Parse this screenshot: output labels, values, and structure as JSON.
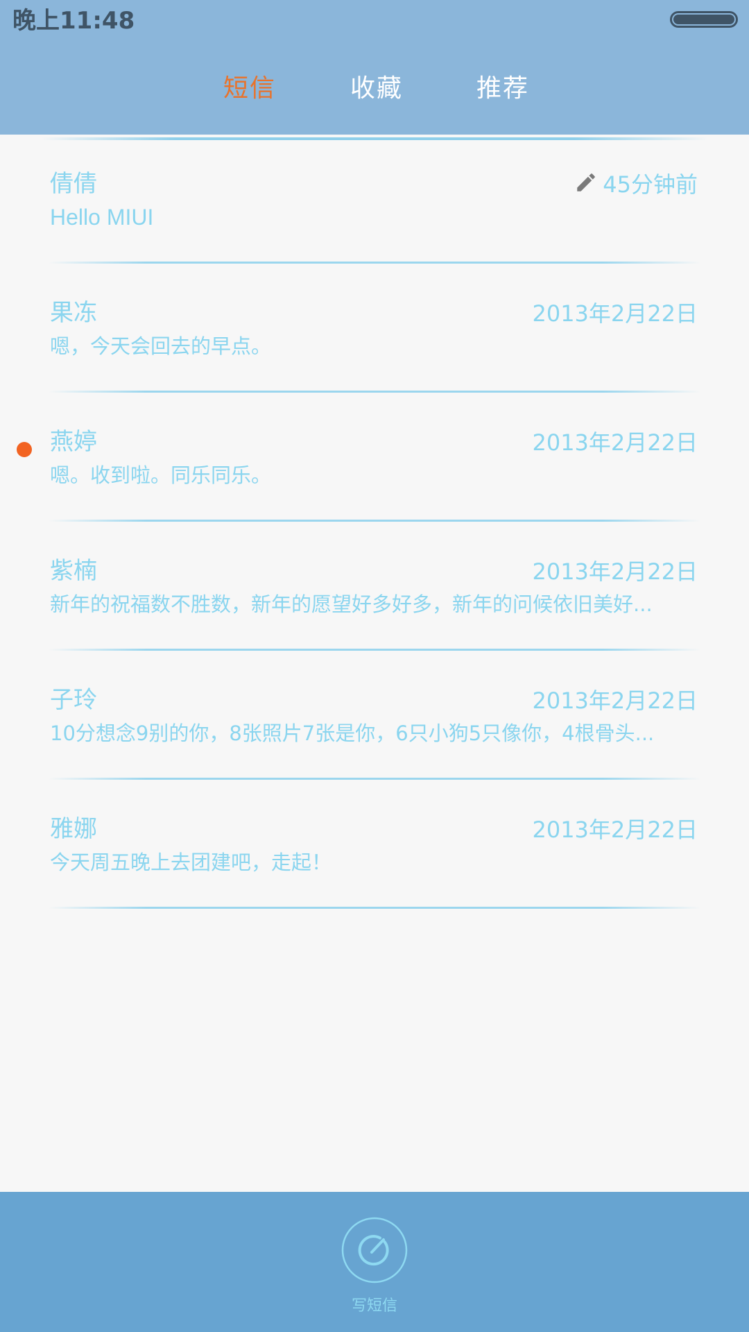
{
  "status_bar": {
    "time": "晚上11:48"
  },
  "tabs": [
    {
      "label": "短信",
      "active": true
    },
    {
      "label": "收藏",
      "active": false
    },
    {
      "label": "推荐",
      "active": false
    }
  ],
  "messages": [
    {
      "name": "倩倩",
      "time": "45分钟前",
      "snippet": "Hello MIUI",
      "draft": true,
      "unread": false
    },
    {
      "name": "果冻",
      "time": "2013年2月22日",
      "snippet": "嗯，今天会回去的早点。",
      "draft": false,
      "unread": false
    },
    {
      "name": "燕婷",
      "time": "2013年2月22日",
      "snippet": "嗯。收到啦。同乐同乐。",
      "draft": false,
      "unread": true
    },
    {
      "name": "紫楠",
      "time": "2013年2月22日",
      "snippet": "新年的祝福数不胜数，新年的愿望好多好多，新年的问候依旧美好...",
      "draft": false,
      "unread": false
    },
    {
      "name": "子玲",
      "time": "2013年2月22日",
      "snippet": "10分想念9别的你，8张照片7张是你，6只小狗5只像你，4根骨头...",
      "draft": false,
      "unread": false
    },
    {
      "name": "雅娜",
      "time": "2013年2月22日",
      "snippet": "今天周五晚上去团建吧，走起！",
      "draft": false,
      "unread": false
    }
  ],
  "bottom_bar": {
    "compose_label": "写短信",
    "compose_icon": "compose-icon"
  },
  "colors": {
    "header_bg": "#8bb6da",
    "active_tab": "#e8732c",
    "text_accent": "#8ad5ef",
    "unread_dot": "#f26322",
    "bottom_bar_bg": "#67a4d1"
  }
}
